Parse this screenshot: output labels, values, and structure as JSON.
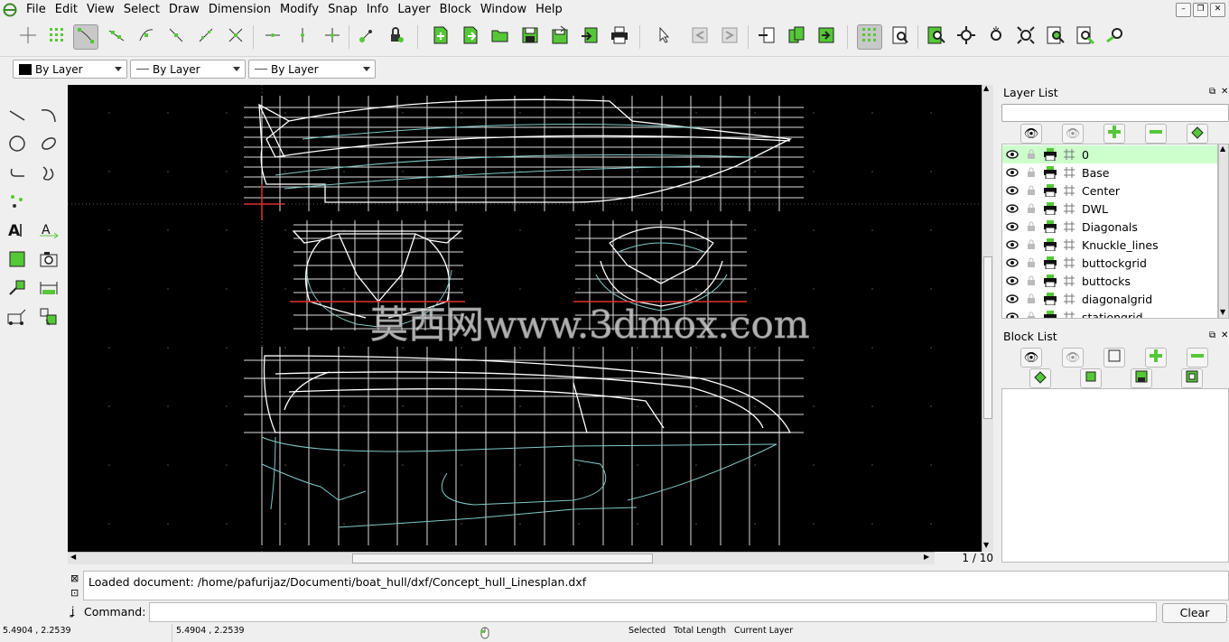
{
  "menu": [
    "File",
    "Edit",
    "View",
    "Select",
    "Draw",
    "Dimension",
    "Modify",
    "Snap",
    "Info",
    "Layer",
    "Block",
    "Window",
    "Help"
  ],
  "attributes": {
    "color": "By Layer",
    "width": "By Layer",
    "linetype": "By Layer"
  },
  "drawing": {
    "watermark": "莫西网www.3dmox.com",
    "page_indicator": "1 / 10"
  },
  "layer_panel": {
    "title": "Layer List",
    "filter": "",
    "layers": [
      {
        "name": "0",
        "active": true
      },
      {
        "name": "Base"
      },
      {
        "name": "Center"
      },
      {
        "name": "DWL"
      },
      {
        "name": "Diagonals"
      },
      {
        "name": "Knuckle_lines"
      },
      {
        "name": "buttockgrid"
      },
      {
        "name": "buttocks"
      },
      {
        "name": "diagonalgrid"
      },
      {
        "name": "stationgrid"
      }
    ]
  },
  "block_panel": {
    "title": "Block List"
  },
  "command": {
    "history": "Loaded document: /home/pafurijaz/Documenti/boat_hull/dxf/Concept_hull_Linesplan.dxf",
    "label": "Command:",
    "value": "",
    "clear": "Clear"
  },
  "status": {
    "abs_coord": "5.4904 , 2.2539",
    "abs_coord2": "5.4904 , 2.2539",
    "selected": "Selected",
    "total_length": "Total Length",
    "current_layer": "Current Layer"
  },
  "colors": {
    "accent": "#55c837",
    "canvas": "#000000",
    "active_layer": "#ccffcc"
  }
}
